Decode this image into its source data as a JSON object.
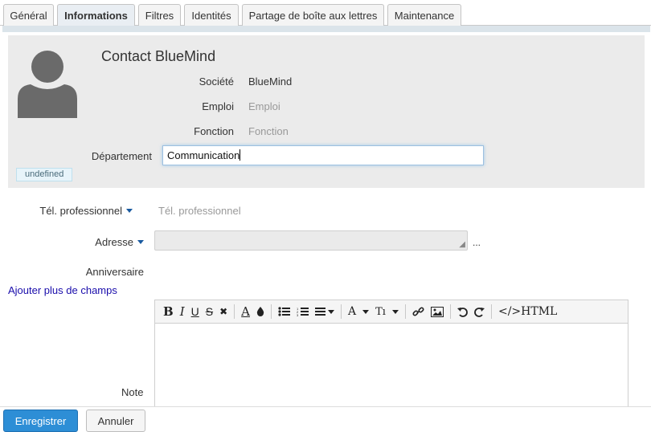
{
  "tabs": [
    {
      "label": "Général",
      "active": false
    },
    {
      "label": "Informations",
      "active": true
    },
    {
      "label": "Filtres",
      "active": false
    },
    {
      "label": "Identités",
      "active": false
    },
    {
      "label": "Partage de boîte aux lettres",
      "active": false
    },
    {
      "label": "Maintenance",
      "active": false
    }
  ],
  "header": {
    "title": "Contact BlueMind",
    "badge": "undefined",
    "societe_label": "Société",
    "societe_value": "BlueMind",
    "emploi_label": "Emploi",
    "emploi_placeholder": "Emploi",
    "fonction_label": "Fonction",
    "fonction_placeholder": "Fonction",
    "departement_label": "Département",
    "departement_value": "Communication"
  },
  "form": {
    "tel_label": "Tél. professionnel",
    "tel_placeholder": "Tél. professionnel",
    "adresse_label": "Adresse",
    "adresse_more": "...",
    "anniversaire_label": "Anniversaire",
    "add_fields_link": "Ajouter plus de champs",
    "note_label": "Note"
  },
  "toolbar": {
    "bold": "B",
    "italic": "I",
    "underline": "U",
    "strike": "S",
    "clear": "✖",
    "font_color": "A",
    "fill": "💧",
    "bullet_list": "☰",
    "numbered_list": "☷",
    "align": "≡",
    "font_family": "A",
    "font_size": "Tı",
    "html": "</>HTML"
  },
  "footer": {
    "save": "Enregistrer",
    "cancel": "Annuler"
  },
  "colors": {
    "primary": "#2d8ed6",
    "header_bg": "#ebebeb",
    "link": "#1a0dab"
  }
}
